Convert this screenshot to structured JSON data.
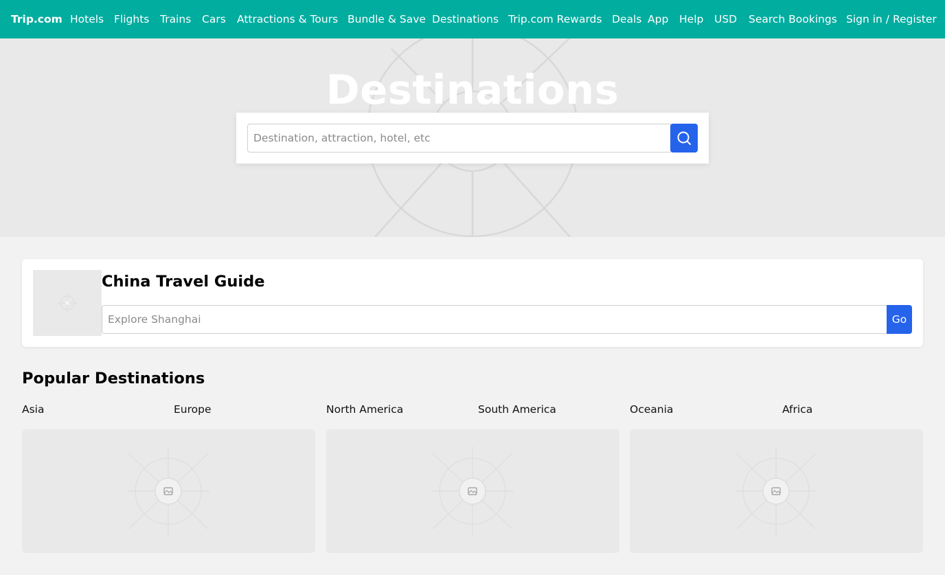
{
  "nav": {
    "brand": "Trip.com",
    "links": [
      "Hotels",
      "Flights",
      "Trains",
      "Cars",
      "Attractions & Tours",
      "Bundle & Save",
      "Destinations",
      "Trip.com Rewards",
      "Deals",
      "App",
      "Help",
      "USD",
      "Search Bookings",
      "Sign in / Register"
    ]
  },
  "hero": {
    "title": "Destinations",
    "search_placeholder": "Destination, attraction, hotel, etc",
    "search_icon": "search-icon"
  },
  "china_guide": {
    "title": "China Travel Guide",
    "input_placeholder": "Explore Shanghai",
    "go_label": "Go",
    "thumb_icon": "image-placeholder-icon"
  },
  "popular": {
    "title": "Popular Destinations",
    "regions": [
      "Asia",
      "Europe",
      "North America",
      "South America",
      "Oceania",
      "Africa"
    ],
    "card_icon": "image-placeholder-icon"
  },
  "colors": {
    "nav_bg": "#00ad9f",
    "accent": "#2563eb",
    "page_bg": "#f2f2f2",
    "placeholder_bg": "#e9e9e9"
  }
}
